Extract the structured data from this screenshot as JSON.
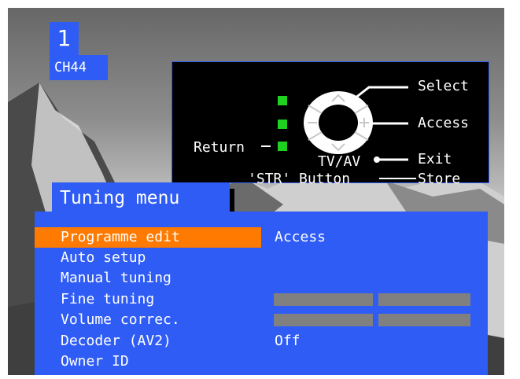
{
  "channel": {
    "number": "1",
    "name": "CH44"
  },
  "help_panel": {
    "select_label": "Select",
    "access_label": "Access",
    "exit_label": "Exit",
    "store_label": "Store",
    "return_label": "Return",
    "tvav_label": "TV/AV",
    "str_button_label": "'STR' Button",
    "led_color": "#1fd21f"
  },
  "menu": {
    "title": "Tuning menu",
    "highlight_color": "#ff7a00",
    "panel_color": "#2f5cf5",
    "items": [
      {
        "label": "Programme edit",
        "value": "Access",
        "selected": true
      },
      {
        "label": "Auto setup",
        "value": ""
      },
      {
        "label": "Manual tuning",
        "value": ""
      },
      {
        "label": "Fine tuning",
        "value": ""
      },
      {
        "label": "Volume correc.",
        "value": ""
      },
      {
        "label": "Decoder (AV2)",
        "value": "Off"
      },
      {
        "label": "Owner ID",
        "value": ""
      }
    ]
  }
}
